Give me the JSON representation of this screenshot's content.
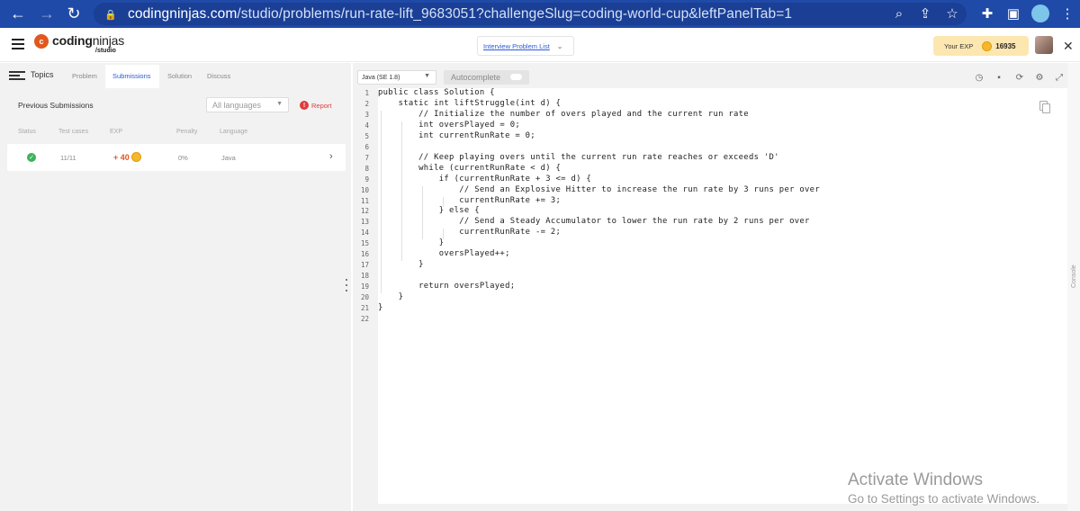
{
  "browser": {
    "url_host": "codingninjas.com",
    "url_path": "/studio/problems/run-rate-lift_9683051?challengeSlug=coding-world-cup&leftPanelTab=1"
  },
  "header": {
    "logo_text_a": "coding",
    "logo_text_b": "ninjas",
    "logo_sub": "/studio",
    "interview_problem_list": "Interview Problem List",
    "exp_label": "Your EXP",
    "exp_value": "16935"
  },
  "left_panel": {
    "topics_label": "Topics",
    "tabs": [
      "Problem",
      "Submissions",
      "Solution",
      "Discuss"
    ],
    "previous_submissions": "Previous Submissions",
    "language_filter": "All languages",
    "report_label": "Report",
    "columns": [
      "Status",
      "Test cases",
      "EXP",
      "Penalty",
      "Language"
    ],
    "submission": {
      "test_cases": "11/11",
      "exp": "+ 40",
      "penalty": "0%",
      "language": "Java"
    }
  },
  "editor": {
    "language": "Java (SE 1.8)",
    "autocomplete_label": "Autocomplete",
    "lines": [
      "public class Solution {",
      "    static int liftStruggle(int d) {",
      "        // Initialize the number of overs played and the current run rate",
      "        int oversPlayed = 0;",
      "        int currentRunRate = 0;",
      "",
      "        // Keep playing overs until the current run rate reaches or exceeds 'D'",
      "        while (currentRunRate < d) {",
      "            if (currentRunRate + 3 <= d) {",
      "                // Send an Explosive Hitter to increase the run rate by 3 runs per over",
      "                currentRunRate += 3;",
      "            } else {",
      "                // Send a Steady Accumulator to lower the run rate by 2 runs per over",
      "                currentRunRate -= 2;",
      "            }",
      "            oversPlayed++;",
      "        }",
      "",
      "        return oversPlayed;",
      "    }",
      "}",
      ""
    ],
    "line_numbers": [
      "1",
      "2",
      "3",
      "4",
      "5",
      "6",
      "7",
      "8",
      "9",
      "10",
      "11",
      "12",
      "13",
      "14",
      "15",
      "16",
      "17",
      "18",
      "19",
      "20",
      "21",
      "22"
    ],
    "console_label": "Console"
  },
  "watermark": {
    "line1": "Activate Windows",
    "line2": "Go to Settings to activate Windows."
  },
  "colors": {
    "browser_bar": "#1f4aa8",
    "accent_blue": "#2a5bd7",
    "exp_orange": "#e2571e",
    "report_red": "#e23b3b",
    "success_green": "#3cb45a"
  }
}
